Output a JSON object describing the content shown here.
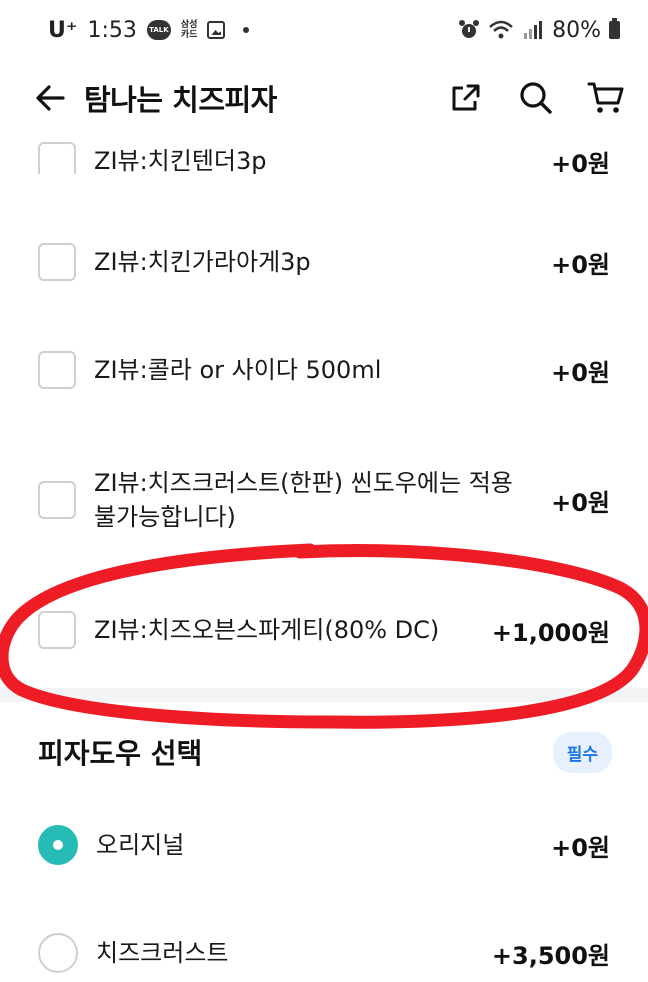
{
  "status_bar": {
    "carrier": "U⁺",
    "time": "1:53",
    "talk_badge": "TALK",
    "card_badge_line1": "삼성",
    "card_badge_line2": "카드",
    "battery": "80%"
  },
  "header": {
    "title": "탐나는 치즈피자",
    "icons": [
      "back-arrow-icon",
      "share-icon",
      "search-icon",
      "cart-icon"
    ]
  },
  "options": [
    {
      "label": "ZI뷰:치킨텐더3p",
      "price": "+0원"
    },
    {
      "label": "ZI뷰:치킨가라아게3p",
      "price": "+0원"
    },
    {
      "label": "ZI뷰:콜라 or 사이다 500ml",
      "price": "+0원"
    },
    {
      "label": "ZI뷰:치즈크러스트(한판) 씬도우에는 적용불가능합니다)",
      "price": "+0원"
    },
    {
      "label": "ZI뷰:치즈오븐스파게티(80% DC)",
      "price": "+1,000원"
    }
  ],
  "dough_section": {
    "title": "피자도우 선택",
    "badge": "필수",
    "choices": [
      {
        "label": "오리지널",
        "price": "+0원",
        "selected": true
      },
      {
        "label": "치즈크러스트",
        "price": "+3,500원",
        "selected": false
      }
    ]
  },
  "colors": {
    "accent": "#26bcb5",
    "badge_text": "#1b76e3",
    "badge_bg": "#e7f1fd",
    "annotation": "#ee1c24"
  }
}
